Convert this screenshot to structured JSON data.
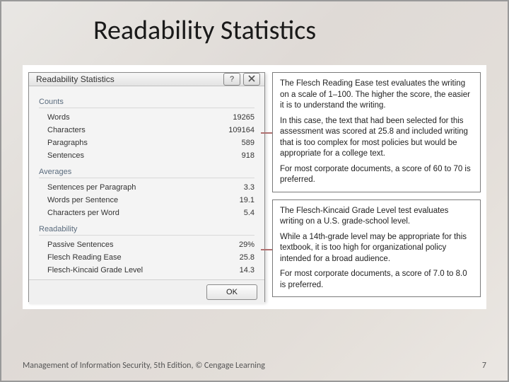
{
  "title": "Readability Statistics",
  "dialog": {
    "title": "Readability Statistics",
    "help": "?",
    "sections": {
      "counts_head": "Counts",
      "averages_head": "Averages",
      "readability_head": "Readability"
    },
    "counts": {
      "words_label": "Words",
      "words_val": "19265",
      "chars_label": "Characters",
      "chars_val": "109164",
      "paras_label": "Paragraphs",
      "paras_val": "589",
      "sents_label": "Sentences",
      "sents_val": "918"
    },
    "averages": {
      "spp_label": "Sentences per Paragraph",
      "spp_val": "3.3",
      "wps_label": "Words per Sentence",
      "wps_val": "19.1",
      "cpw_label": "Characters per Word",
      "cpw_val": "5.4"
    },
    "readability": {
      "passive_label": "Passive Sentences",
      "passive_val": "29%",
      "fre_label": "Flesch Reading Ease",
      "fre_val": "25.8",
      "fkg_label": "Flesch-Kincaid Grade Level",
      "fkg_val": "14.3"
    },
    "ok": "OK"
  },
  "box1": {
    "p1": "The Flesch Reading Ease test evaluates the writing on a scale of 1–100. The higher the score, the easier it is to understand the writing.",
    "p2": "In this case, the text that had been selected for this assessment was scored at 25.8 and included writing that is too complex for most policies but would be appropriate for a college text.",
    "p3": "For most corporate documents, a score of 60 to 70 is preferred."
  },
  "box2": {
    "p1": "The Flesch-Kincaid Grade Level test evaluates writing on a U.S. grade-school level.",
    "p2": "While a 14th-grade level may be appropriate for this textbook, it is too high for organizational policy intended for a broad audience.",
    "p3": "For most corporate documents, a score of 7.0 to 8.0 is preferred."
  },
  "footer": {
    "text": "Management of Information Security, 5th Edition, © Cengage Learning",
    "page": "7"
  },
  "chart_data": {
    "type": "table",
    "title": "Readability Statistics",
    "series": [
      {
        "name": "Counts",
        "rows": [
          {
            "label": "Words",
            "value": 19265
          },
          {
            "label": "Characters",
            "value": 109164
          },
          {
            "label": "Paragraphs",
            "value": 589
          },
          {
            "label": "Sentences",
            "value": 918
          }
        ]
      },
      {
        "name": "Averages",
        "rows": [
          {
            "label": "Sentences per Paragraph",
            "value": 3.3
          },
          {
            "label": "Words per Sentence",
            "value": 19.1
          },
          {
            "label": "Characters per Word",
            "value": 5.4
          }
        ]
      },
      {
        "name": "Readability",
        "rows": [
          {
            "label": "Passive Sentences",
            "value": "29%"
          },
          {
            "label": "Flesch Reading Ease",
            "value": 25.8
          },
          {
            "label": "Flesch-Kincaid Grade Level",
            "value": 14.3
          }
        ]
      }
    ]
  }
}
